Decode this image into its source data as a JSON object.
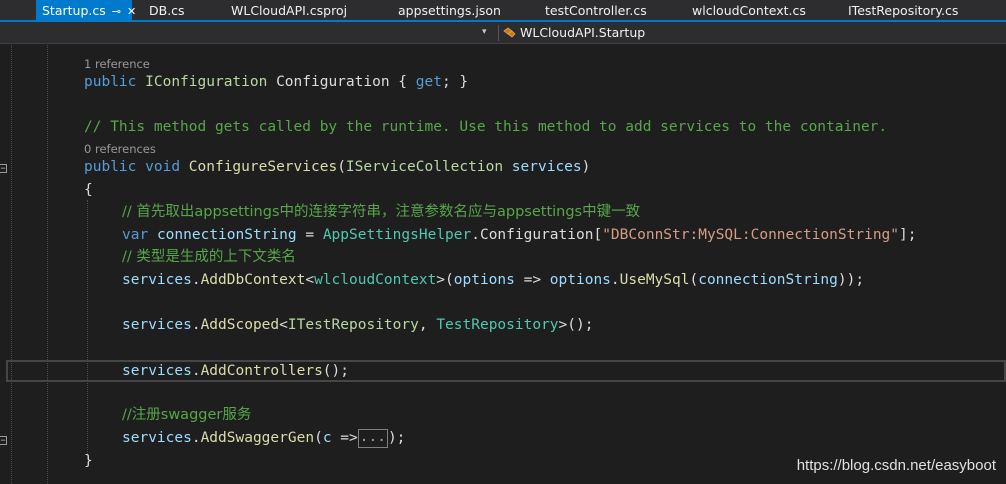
{
  "tabs": [
    {
      "label": "Startup.cs",
      "active": true,
      "pin": "⊸",
      "close": "✕"
    },
    {
      "label": "DB.cs"
    },
    {
      "label": "WLCloudAPI.csproj"
    },
    {
      "label": "appsettings.json"
    },
    {
      "label": "testController.cs"
    },
    {
      "label": "wlcloudContext.cs"
    },
    {
      "label": "ITestRepository.cs"
    }
  ],
  "nav": {
    "type_label": "WLCloudAPI.Startup",
    "dropdown_arrow": "▾"
  },
  "lens": {
    "ref1": "1 reference",
    "ref0": "0 references"
  },
  "code": {
    "l1": {
      "kw": "public",
      "type": "IConfiguration",
      "name": " Configuration ",
      "brace_open": "{ ",
      "get": "get",
      "tail": "; }"
    },
    "comment1": "// This method gets called by the runtime. Use this method to add services to the container.",
    "l2": {
      "kw1": "public",
      "kw2": "void",
      "method": "ConfigureServices",
      "open": "(",
      "type": "IServiceCollection",
      "param": "services",
      "close": ")"
    },
    "brace_open": "{",
    "comment2": "// 首先取出appsettings中的连接字符串，注意参数名应与appsettings中键一致",
    "l3": {
      "kw": "var",
      "name": "connectionString",
      "eq": " = ",
      "cls": "AppSettingsHelper",
      "dot": ".",
      "prop": "Configuration",
      "lb": "[",
      "str": "\"DBConnStr:MySQL:ConnectionString\"",
      "rb": "];"
    },
    "comment3": "// 类型是生成的上下文类名",
    "l4": {
      "obj": "services",
      "dot": ".",
      "method": "AddDbContext",
      "lt": "<",
      "type": "wlcloudContext",
      "gt": ">(",
      "p1": "options",
      "arrow": " => ",
      "p2": "options",
      "dot2": ".",
      "m2": "UseMySql",
      "op": "(",
      "arg": "connectionString",
      "cp": "));"
    },
    "l5": {
      "obj": "services",
      "dot": ".",
      "method": "AddScoped",
      "lt": "<",
      "t1": "ITestRepository",
      "comma": ", ",
      "t2": "TestRepository",
      "tail": ">();"
    },
    "l6": {
      "obj": "services",
      "dot": ".",
      "method": "AddControllers",
      "tail": "();"
    },
    "comment4": "//注册swagger服务",
    "l7": {
      "obj": "services",
      "dot": ".",
      "method": "AddSwaggerGen",
      "open": "(",
      "param": "c",
      "arrow": " =>",
      "fold": "...",
      "tail": ");"
    },
    "brace_close": "}"
  },
  "watermark": "https://blog.csdn.net/easyboot"
}
